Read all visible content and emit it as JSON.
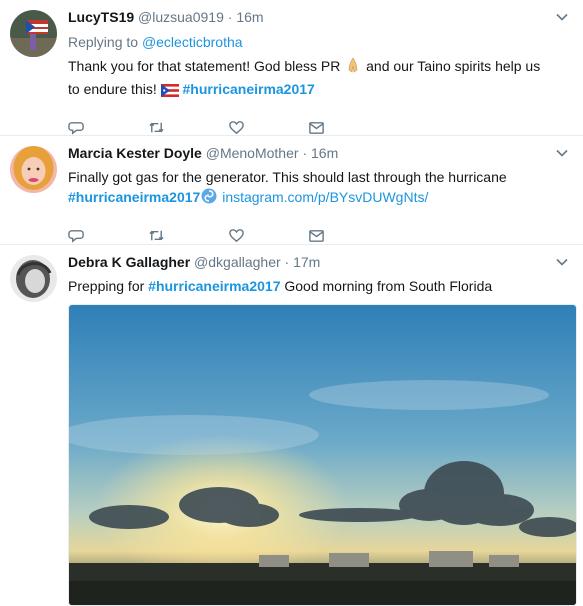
{
  "tweets": [
    {
      "name": "LucyTS19",
      "handle": "@luzsua0919",
      "sep": "·",
      "time": "16m",
      "replying_prefix": "Replying to",
      "replying_handle": "@eclecticbrotha",
      "text_part1": "Thank you for that statement! God bless PR",
      "text_part2": "and our Taino spirits help us to endure this!",
      "hashtag": "#hurricaneirma2017",
      "emoji1": "praying-hands-emoji",
      "emoji2": "puerto-rico-flag-emoji"
    },
    {
      "name": "Marcia Kester Doyle",
      "handle": "@MenoMother",
      "sep": "·",
      "time": "16m",
      "text_part1": "Finally got gas for the generator. This should last through the hurricane",
      "hashtag": "#hurricaneirma2017",
      "emoji": "cyclone-emoji",
      "link": "instagram.com/p/BYsvDUWgNts/"
    },
    {
      "name": "Debra K Gallagher",
      "handle": "@dkgallagher",
      "sep": "·",
      "time": "17m",
      "text_part1": "Prepping for",
      "hashtag": "#hurricaneirma2017",
      "text_part2": "Good morning from South Florida"
    }
  ],
  "icons": {
    "reply": "reply-icon",
    "retweet": "retweet-icon",
    "like": "heart-icon",
    "dm": "envelope-icon",
    "more": "chevron-down-icon"
  },
  "colors": {
    "accent": "#1b95e0",
    "muted": "#657786",
    "text": "#14171a",
    "border": "#e6ecf0"
  }
}
